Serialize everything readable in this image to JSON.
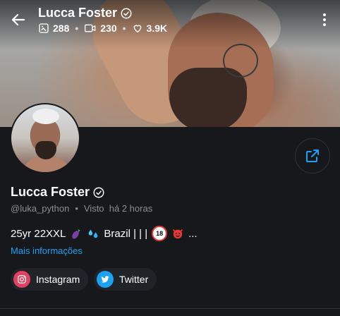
{
  "header": {
    "title": "Lucca Foster",
    "stats": {
      "photos": "288",
      "videos": "230",
      "likes": "3.9K"
    }
  },
  "profile": {
    "name": "Lucca Foster",
    "handle": "@luka_python",
    "last_seen": "Visto  há 2 horas",
    "bio_text_1": "25yr 22XXL",
    "bio_text_2": "Brazil | | |",
    "bio_ellipsis": "...",
    "more_info": "Mais informações",
    "age_badge": "18"
  },
  "social": {
    "instagram": "Instagram",
    "twitter": "Twitter"
  },
  "colors": {
    "accent": "#1da1f2",
    "background": "#16181c",
    "instagram": "#e4405f",
    "twitter": "#1da1f2"
  }
}
